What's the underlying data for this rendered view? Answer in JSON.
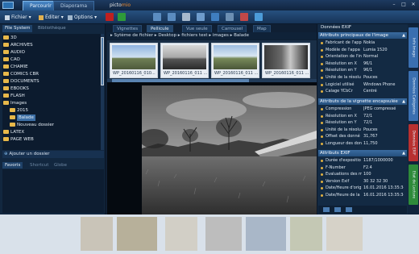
{
  "app": {
    "tabs": [
      {
        "label": "Parcourir"
      },
      {
        "label": "Diaporama"
      }
    ],
    "logo": {
      "part1": "picto",
      "part2": "mio"
    }
  },
  "window_controls": {
    "minimize": "–",
    "maximize": "□",
    "close": "✕"
  },
  "toolbar": {
    "menus": [
      {
        "label": "Fichier"
      },
      {
        "label": "Éditer"
      },
      {
        "label": "Options"
      }
    ]
  },
  "left_panel": {
    "tabs": [
      {
        "label": "File System"
      },
      {
        "label": "Bibliothèque"
      }
    ],
    "tree": [
      {
        "label": "3D"
      },
      {
        "label": "ARCHIVES"
      },
      {
        "label": "AUDIO"
      },
      {
        "label": "CAO"
      },
      {
        "label": "CHAMIE"
      },
      {
        "label": "COMICS CBR"
      },
      {
        "label": "DOCUMENTS"
      },
      {
        "label": "EBOOKS"
      },
      {
        "label": "FLASH"
      },
      {
        "label": "Images"
      },
      {
        "label": "2015"
      },
      {
        "label": "Balade"
      },
      {
        "label": "Nouveau dossier"
      },
      {
        "label": "LATEX"
      },
      {
        "label": "PAGE WEB"
      }
    ],
    "add_folder": "Ajouter un dossier",
    "bottom_tabs": [
      {
        "label": "Favoris"
      },
      {
        "label": "Shortcut"
      },
      {
        "label": "Globe"
      }
    ]
  },
  "center": {
    "tabs": [
      {
        "label": "Vignettes"
      },
      {
        "label": "Pellicule"
      },
      {
        "label": "Vue seule"
      },
      {
        "label": "Carrousel"
      },
      {
        "label": "Map"
      }
    ],
    "breadcrumb": "▸ Sytème de fichier ▸ Desktop ▸ fichiers test ▸ images ▸ Balade",
    "thumbnails": [
      {
        "caption": "WP_20160116_010..."
      },
      {
        "caption": "WP_20160116_011 ..."
      },
      {
        "caption": "WP_20160116_011 ..."
      },
      {
        "caption": "WP_20160116_011 ..."
      }
    ]
  },
  "right_panel": {
    "header": "Données EXIF",
    "sections": [
      {
        "title": "Attributs principaux de l'image",
        "rows": [
          {
            "key": "Fabricant de l'appa",
            "value": "Nokia"
          },
          {
            "key": "Modèle de l'appa",
            "value": "Lumia 1520"
          },
          {
            "key": "Orientation de l'in",
            "value": "Normal"
          },
          {
            "key": "Résolution en X",
            "value": "96/1"
          },
          {
            "key": "Résolution en Y",
            "value": "96/1"
          },
          {
            "key": "Unité de la résolu",
            "value": "Pouces"
          },
          {
            "key": "Logiciel utilisé",
            "value": "Windows Phone"
          },
          {
            "key": "Calage YCbCr",
            "value": "Centré"
          }
        ]
      },
      {
        "title": "Attributs de la vignette encapsulée",
        "rows": [
          {
            "key": "Compression",
            "value": "JPEG compressé"
          },
          {
            "key": "Résolution en X",
            "value": "72/1"
          },
          {
            "key": "Résolution en Y",
            "value": "72/1"
          },
          {
            "key": "Unité de la résolu",
            "value": "Pouces"
          },
          {
            "key": "Offset des donné",
            "value": "31,767"
          },
          {
            "key": "Longueur des don",
            "value": "11,750"
          }
        ]
      },
      {
        "title": "Attributs EXIF",
        "rows": [
          {
            "key": "Durée d'expositio",
            "value": "1187/1000000"
          },
          {
            "key": "F-Number",
            "value": "F2.4"
          },
          {
            "key": "Evaluations des m",
            "value": "100"
          },
          {
            "key": "Version Exif",
            "value": "30 32 32 30"
          },
          {
            "key": "Date/Heure d'origi",
            "value": "16.01.2016 13:35:34"
          },
          {
            "key": "Date/Heure de la",
            "value": "16.01.2016 13:35:34"
          }
        ]
      }
    ]
  },
  "side_tabs": [
    {
      "label": "Info Image",
      "color": "#3a6fb0"
    },
    {
      "label": "Données Catégories",
      "color": "#3a6fb0"
    },
    {
      "label": "Données EXIF",
      "color": "#b83030"
    },
    {
      "label": "Etat de Lecture",
      "color": "#2e8a3a"
    }
  ],
  "colors": {
    "accent": "#3d6fa5",
    "folder": "#e7b84a",
    "logo_accent": "#f08a2a"
  }
}
